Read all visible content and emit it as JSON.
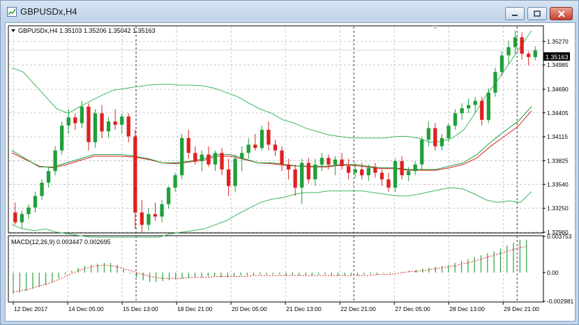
{
  "window": {
    "title": "GBPUSDx,H4",
    "minimize_icon": "minimize-icon",
    "restore_icon": "restore-icon",
    "close_icon": "close-icon"
  },
  "chart_header": {
    "symbol": "GBPUSDx,H4",
    "ohlc": "1.35103 1.35206 1.35042 1.35163",
    "full_text": "GBPUSDx,H4  1.35103 1.35206 1.35042 1.35163"
  },
  "price_tag": "1.35163",
  "macd_header": "MACD(12,26,9) 0.003447 0.002695",
  "colors": {
    "bull": "#1fa03a",
    "bear": "#e02020",
    "bands": "#3cb85c",
    "ma_red": "#d81a1a",
    "ma_green": "#1f9c3a",
    "grid": "#b0b0b0",
    "signal": "#e02020"
  },
  "chart_data": [
    {
      "type": "candlestick",
      "title": "GBPUSDx,H4",
      "y_ticks": [
        "1.35270",
        "1.34985",
        "1.34690",
        "1.34405",
        "1.34115",
        "1.33825",
        "1.33540",
        "1.33250",
        "1.32960"
      ],
      "ylim": [
        1.3296,
        1.3545
      ],
      "x_ticks": [
        "12 Dec 2017",
        "14 Dec 05:00",
        "15 Dec 13:00",
        "18 Dec 21:00",
        "20 Dec 05:00",
        "21 Dec 13:00",
        "22 Dec 21:00",
        "27 Dec 05:00",
        "28 Dec 13:00",
        "29 Dec 21:00"
      ],
      "last_price": 1.35163,
      "candles": [
        [
          1.332,
          1.3332,
          1.3305,
          1.3308
        ],
        [
          1.3308,
          1.3322,
          1.33,
          1.3318
        ],
        [
          1.3318,
          1.333,
          1.3312,
          1.3326
        ],
        [
          1.3326,
          1.3345,
          1.332,
          1.334
        ],
        [
          1.334,
          1.336,
          1.3335,
          1.3356
        ],
        [
          1.3356,
          1.3375,
          1.335,
          1.337
        ],
        [
          1.337,
          1.34,
          1.3365,
          1.3395
        ],
        [
          1.3395,
          1.343,
          1.339,
          1.3425
        ],
        [
          1.3425,
          1.3445,
          1.3415,
          1.3435
        ],
        [
          1.3435,
          1.344,
          1.342,
          1.3428
        ],
        [
          1.3428,
          1.3455,
          1.3422,
          1.3448
        ],
        [
          1.3448,
          1.3452,
          1.3395,
          1.3405
        ],
        [
          1.3405,
          1.3445,
          1.3398,
          1.344
        ],
        [
          1.344,
          1.345,
          1.341,
          1.3418
        ],
        [
          1.3418,
          1.3435,
          1.341,
          1.343
        ],
        [
          1.343,
          1.3445,
          1.342,
          1.3426
        ],
        [
          1.3426,
          1.344,
          1.3415,
          1.3436
        ],
        [
          1.3436,
          1.344,
          1.3405,
          1.3412
        ],
        [
          1.3412,
          1.342,
          1.33,
          1.332
        ],
        [
          1.332,
          1.3335,
          1.3295,
          1.3305
        ],
        [
          1.3305,
          1.3325,
          1.3298,
          1.3318
        ],
        [
          1.3318,
          1.3332,
          1.331,
          1.3315
        ],
        [
          1.3315,
          1.3335,
          1.3308,
          1.333
        ],
        [
          1.333,
          1.3352,
          1.3325,
          1.335
        ],
        [
          1.335,
          1.3368,
          1.3345,
          1.3365
        ],
        [
          1.3365,
          1.3415,
          1.336,
          1.341
        ],
        [
          1.341,
          1.342,
          1.3385,
          1.3392
        ],
        [
          1.3392,
          1.34,
          1.3378,
          1.3382
        ],
        [
          1.3382,
          1.3395,
          1.337,
          1.339
        ],
        [
          1.339,
          1.34,
          1.3375,
          1.3378
        ],
        [
          1.3378,
          1.3395,
          1.337,
          1.3392
        ],
        [
          1.3392,
          1.3398,
          1.3365,
          1.3372
        ],
        [
          1.3372,
          1.3385,
          1.334,
          1.3352
        ],
        [
          1.3352,
          1.339,
          1.3345,
          1.3385
        ],
        [
          1.3385,
          1.34,
          1.337,
          1.3392
        ],
        [
          1.3392,
          1.341,
          1.3385,
          1.3402
        ],
        [
          1.3402,
          1.3415,
          1.3395,
          1.3398
        ],
        [
          1.3398,
          1.3425,
          1.3395,
          1.342
        ],
        [
          1.342,
          1.343,
          1.3395,
          1.3402
        ],
        [
          1.3402,
          1.3408,
          1.3388,
          1.3395
        ],
        [
          1.3395,
          1.34,
          1.337,
          1.3378
        ],
        [
          1.3378,
          1.3385,
          1.336,
          1.3372
        ],
        [
          1.3372,
          1.3378,
          1.334,
          1.335
        ],
        [
          1.335,
          1.3385,
          1.333,
          1.338
        ],
        [
          1.338,
          1.3386,
          1.3355,
          1.336
        ],
        [
          1.336,
          1.3385,
          1.3352,
          1.3378
        ],
        [
          1.3378,
          1.3392,
          1.337,
          1.3386
        ],
        [
          1.3386,
          1.339,
          1.3372,
          1.3378
        ],
        [
          1.3378,
          1.3388,
          1.3365,
          1.3384
        ],
        [
          1.3384,
          1.3392,
          1.3372,
          1.3376
        ],
        [
          1.3376,
          1.3385,
          1.336,
          1.3368
        ],
        [
          1.3368,
          1.338,
          1.3362,
          1.3372
        ],
        [
          1.3372,
          1.338,
          1.336,
          1.3365
        ],
        [
          1.3365,
          1.3378,
          1.3358,
          1.3374
        ],
        [
          1.3374,
          1.338,
          1.3362,
          1.3368
        ],
        [
          1.3368,
          1.3372,
          1.3352,
          1.336
        ],
        [
          1.336,
          1.3368,
          1.3345,
          1.335
        ],
        [
          1.335,
          1.3385,
          1.3345,
          1.3382
        ],
        [
          1.3382,
          1.3388,
          1.336,
          1.3365
        ],
        [
          1.3365,
          1.3375,
          1.3358,
          1.337
        ],
        [
          1.337,
          1.3382,
          1.3365,
          1.3378
        ],
        [
          1.3378,
          1.3412,
          1.3372,
          1.3408
        ],
        [
          1.3408,
          1.343,
          1.34,
          1.3422
        ],
        [
          1.3422,
          1.3428,
          1.3395,
          1.34
        ],
        [
          1.34,
          1.3415,
          1.3395,
          1.341
        ],
        [
          1.341,
          1.3428,
          1.3405,
          1.3425
        ],
        [
          1.3425,
          1.3445,
          1.342,
          1.344
        ],
        [
          1.344,
          1.3452,
          1.3432,
          1.3446
        ],
        [
          1.3446,
          1.3458,
          1.344,
          1.345
        ],
        [
          1.345,
          1.346,
          1.344,
          1.3455
        ],
        [
          1.3455,
          1.346,
          1.3425,
          1.3432
        ],
        [
          1.3432,
          1.347,
          1.3428,
          1.3465
        ],
        [
          1.3465,
          1.3495,
          1.346,
          1.349
        ],
        [
          1.349,
          1.3515,
          1.3485,
          1.351
        ],
        [
          1.351,
          1.3528,
          1.35,
          1.352
        ],
        [
          1.352,
          1.354,
          1.3512,
          1.3532
        ],
        [
          1.3532,
          1.3538,
          1.3505,
          1.3512
        ],
        [
          1.3512,
          1.3515,
          1.3498,
          1.3508
        ],
        [
          1.3508,
          1.3521,
          1.3504,
          1.3516
        ]
      ],
      "bollinger_upper": [
        1.3495,
        1.349,
        1.3475,
        1.346,
        1.3445,
        1.344,
        1.3448,
        1.3455,
        1.3462,
        1.3468,
        1.347,
        1.3472,
        1.3474,
        1.3475,
        1.3475,
        1.3474,
        1.3474,
        1.3473,
        1.347,
        1.3465,
        1.346,
        1.3452,
        1.3445,
        1.344,
        1.3432,
        1.3428,
        1.3422,
        1.3418,
        1.3414,
        1.3412,
        1.341,
        1.341,
        1.341,
        1.341,
        1.3412,
        1.3412,
        1.341,
        1.3405,
        1.3406,
        1.341,
        1.342,
        1.344,
        1.3462,
        1.348,
        1.35,
        1.352,
        1.354
      ],
      "bollinger_lower": [
        1.3305,
        1.33,
        1.3298,
        1.33,
        1.3296,
        1.3294,
        1.3292,
        1.329,
        1.329,
        1.329,
        1.329,
        1.329,
        1.329,
        1.329,
        1.3294,
        1.3296,
        1.3298,
        1.33,
        1.3305,
        1.331,
        1.3318,
        1.3325,
        1.3332,
        1.3336,
        1.3338,
        1.3342,
        1.3344,
        1.3344,
        1.3346,
        1.3346,
        1.3346,
        1.3346,
        1.3344,
        1.3342,
        1.334,
        1.334,
        1.3342,
        1.3345,
        1.3348,
        1.335,
        1.3348,
        1.3342,
        1.3335,
        1.3332,
        1.3334,
        1.3332,
        1.3345
      ],
      "ma_fast": [
        1.3395,
        1.3385,
        1.3375,
        1.3375,
        1.338,
        1.3385,
        1.339,
        1.339,
        1.339,
        1.3388,
        1.3385,
        1.338,
        1.338,
        1.3382,
        1.3385,
        1.339,
        1.339,
        1.3385,
        1.338,
        1.338,
        1.3378,
        1.3376,
        1.3376,
        1.3376,
        1.3378,
        1.3378,
        1.3376,
        1.3374,
        1.3374,
        1.3372,
        1.3372,
        1.3372,
        1.3376,
        1.338,
        1.339,
        1.3405,
        1.3418,
        1.343,
        1.3448
      ],
      "ma_slow": [
        1.3392,
        1.3384,
        1.3376,
        1.3374,
        1.3378,
        1.3383,
        1.3388,
        1.3388,
        1.3388,
        1.3387,
        1.3384,
        1.338,
        1.3379,
        1.3381,
        1.3383,
        1.3388,
        1.3388,
        1.3384,
        1.338,
        1.3379,
        1.3377,
        1.3376,
        1.3375,
        1.3375,
        1.3377,
        1.3377,
        1.3375,
        1.3373,
        1.3373,
        1.3371,
        1.3371,
        1.3371,
        1.3374,
        1.3378,
        1.3386,
        1.34,
        1.3412,
        1.3424,
        1.3443
      ]
    },
    {
      "type": "bar",
      "title": "MACD(12,26,9) 0.003447 0.002695",
      "y_ticks": [
        "0.003753",
        "0.00",
        "-0.002981"
      ],
      "ylim": [
        -0.002981,
        0.003753
      ],
      "histogram": [
        -0.0022,
        -0.0021,
        -0.0019,
        -0.0017,
        -0.0015,
        -0.0013,
        -0.001,
        -0.0006,
        -0.0002,
        0.0002,
        0.0005,
        0.0007,
        0.0008,
        0.0009,
        0.001,
        0.001,
        0.0008,
        0.0004,
        -0.0001,
        -0.0005,
        -0.0008,
        -0.001,
        -0.001,
        -0.0009,
        -0.0008,
        -0.0007,
        -0.0006,
        -0.0006,
        -0.0005,
        -0.0005,
        -0.0004,
        -0.0004,
        -0.0005,
        -0.0005,
        -0.0004,
        -0.0003,
        -0.0003,
        -0.0003,
        -0.0002,
        -0.0002,
        -0.0002,
        -0.0002,
        -0.0003,
        -0.0003,
        -0.0003,
        -0.0003,
        -0.0003,
        -0.0002,
        -0.0002,
        -0.0003,
        -0.0003,
        -0.0003,
        -0.0003,
        -0.0003,
        -0.0002,
        -0.0002,
        -0.0002,
        -0.0001,
        -0.0001,
        0.0,
        0.0001,
        0.0002,
        0.0003,
        0.0004,
        0.0005,
        0.0006,
        0.0007,
        0.0008,
        0.001,
        0.0012,
        0.0014,
        0.0016,
        0.0018,
        0.002,
        0.0022,
        0.0025,
        0.0028,
        0.0031,
        0.0034,
        0.0034
      ],
      "signal": [
        -0.002,
        -0.0019,
        -0.0018,
        -0.0016,
        -0.0014,
        -0.0012,
        -0.001,
        -0.0007,
        -0.0004,
        -0.0001,
        0.0002,
        0.0004,
        0.0006,
        0.0007,
        0.0008,
        0.0007,
        0.0006,
        0.0004,
        0.0002,
        0.0,
        -0.0002,
        -0.0004,
        -0.0005,
        -0.0006,
        -0.0006,
        -0.0006,
        -0.0006,
        -0.0005,
        -0.0005,
        -0.0005,
        -0.0005,
        -0.0004,
        -0.0004,
        -0.0004,
        -0.0004,
        -0.0004,
        -0.0004,
        -0.0003,
        -0.0003,
        -0.0003,
        -0.0003,
        -0.0003,
        -0.0003,
        -0.0003,
        -0.0003,
        -0.0003,
        -0.0003,
        -0.0003,
        -0.0003,
        -0.0003,
        -0.0003,
        -0.0003,
        -0.0003,
        -0.0003,
        -0.0003,
        -0.0003,
        -0.0002,
        -0.0002,
        -0.0002,
        -0.0001,
        0.0,
        0.0001,
        0.0001,
        0.0002,
        0.0003,
        0.0004,
        0.0005,
        0.0006,
        0.0007,
        0.0009,
        0.001,
        0.0012,
        0.0014,
        0.0016,
        0.0018,
        0.002,
        0.0022,
        0.0024,
        0.0026,
        0.0027
      ]
    }
  ]
}
